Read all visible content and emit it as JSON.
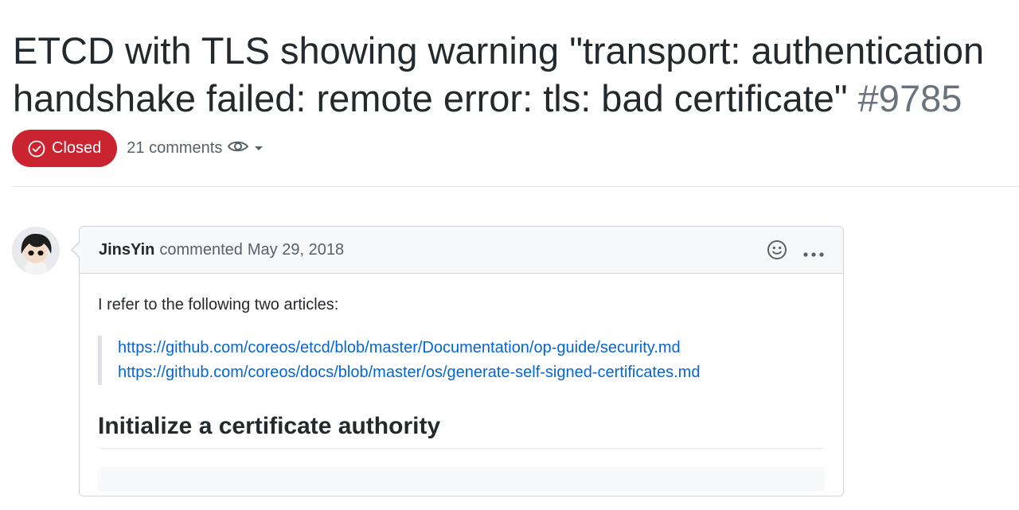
{
  "issue": {
    "title": "ETCD with TLS showing warning \"transport: authentication handshake failed: remote error: tls: bad certificate\"",
    "number": "#9785",
    "state": "Closed",
    "comments_count": "21 comments"
  },
  "comment": {
    "author": "JinsYin",
    "action": "commented",
    "date": "May 29, 2018",
    "intro": "I refer to the following two articles:",
    "links": [
      "https://github.com/coreos/etcd/blob/master/Documentation/op-guide/security.md",
      "https://github.com/coreos/docs/blob/master/os/generate-self-signed-certificates.md"
    ],
    "heading": "Initialize a certificate authority"
  },
  "icons": {
    "state": "circle-check-icon",
    "watch": "eye-icon",
    "reaction": "smiley-icon",
    "more": "kebab-icon"
  },
  "colors": {
    "closed": "#cb2431",
    "link": "#0366d6",
    "muted": "#586069"
  }
}
